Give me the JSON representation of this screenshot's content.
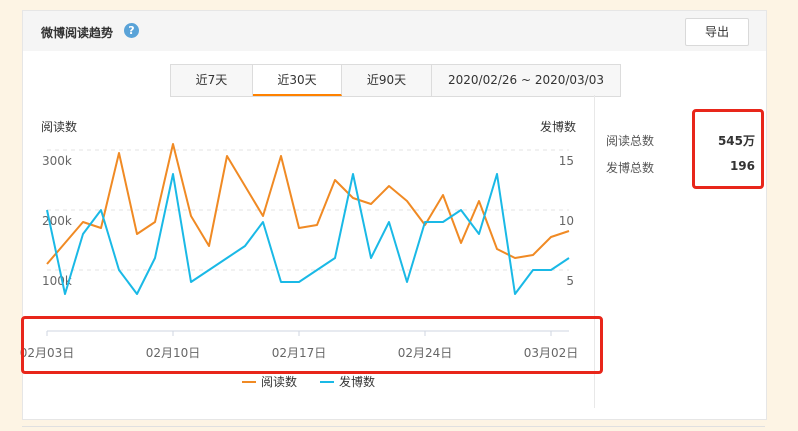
{
  "header": {
    "title": "微博阅读趋势",
    "help_icon": "?",
    "export_label": "导出"
  },
  "tabs": [
    {
      "label": "近7天",
      "active": false
    },
    {
      "label": "近30天",
      "active": true
    },
    {
      "label": "近90天",
      "active": false
    },
    {
      "label": "2020/02/26 ~ 2020/03/03",
      "active": false
    }
  ],
  "stats": {
    "reads_label": "阅读总数",
    "reads_value": "545万",
    "posts_label": "发博总数",
    "posts_value": "196"
  },
  "colors": {
    "reads": "#f08a24",
    "posts": "#1ab9e6",
    "accent": "#ff8200",
    "highlight": "#e8261a"
  },
  "chart_data": {
    "type": "line",
    "ylabel_left": "阅读数",
    "ylabel_right": "发博数",
    "left_ticks": [
      "300k",
      "200k",
      "100k"
    ],
    "right_ticks": [
      "15",
      "10",
      "5"
    ],
    "x_tick_labels": [
      "02月03日",
      "02月10日",
      "02月17日",
      "02月24日",
      "03月02日"
    ],
    "x": [
      "02/03",
      "02/04",
      "02/05",
      "02/06",
      "02/07",
      "02/08",
      "02/09",
      "02/10",
      "02/11",
      "02/12",
      "02/13",
      "02/14",
      "02/15",
      "02/16",
      "02/17",
      "02/18",
      "02/19",
      "02/20",
      "02/21",
      "02/22",
      "02/23",
      "02/24",
      "02/25",
      "02/26",
      "02/27",
      "02/28",
      "02/29",
      "03/01",
      "03/02",
      "03/03"
    ],
    "series": [
      {
        "name": "阅读数",
        "axis": "left",
        "color": "#f08a24",
        "values": [
          110,
          145,
          180,
          170,
          295,
          160,
          180,
          310,
          190,
          140,
          290,
          240,
          190,
          290,
          170,
          175,
          250,
          220,
          210,
          240,
          215,
          175,
          225,
          145,
          215,
          135,
          120,
          125,
          155,
          165
        ]
      },
      {
        "name": "发博数",
        "axis": "right",
        "color": "#1ab9e6",
        "values": [
          10,
          3,
          8,
          10,
          5,
          3,
          6,
          13,
          4,
          5,
          6,
          7,
          9,
          4,
          4,
          5,
          6,
          13,
          6,
          9,
          4,
          9,
          9,
          10,
          8,
          13,
          3,
          5,
          5,
          6
        ]
      }
    ],
    "legend": "bottom"
  }
}
